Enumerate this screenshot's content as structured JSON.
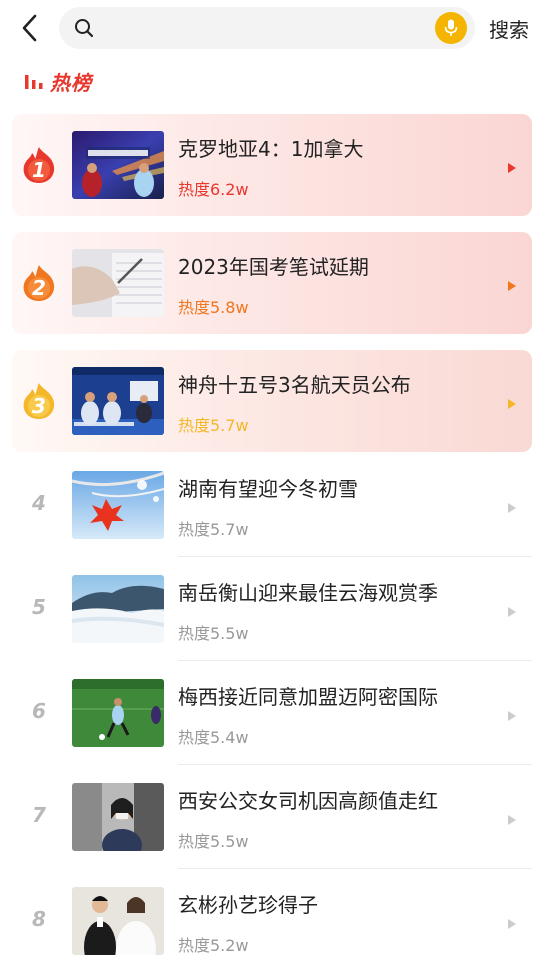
{
  "search": {
    "placeholder": "",
    "value": "",
    "button_label": "搜索"
  },
  "section": {
    "title": "热榜"
  },
  "colors": {
    "accent_red": "#e8372d",
    "accent_orange": "#f0761f",
    "accent_yellow": "#f5b72a",
    "mic_bg": "#f4b400"
  },
  "items": [
    {
      "rank": "1",
      "title": "克罗地亚4：1加拿大",
      "heat": "热度6.2w",
      "image": "world-cup-news-thumbnail"
    },
    {
      "rank": "2",
      "title": "2023年国考笔试延期",
      "heat": "热度5.8w",
      "image": "exam-paper-writing-thumbnail"
    },
    {
      "rank": "3",
      "title": "神舟十五号3名航天员公布",
      "heat": "热度5.7w",
      "image": "astronauts-press-conference-thumbnail"
    },
    {
      "rank": "4",
      "title": "湖南有望迎今冬初雪",
      "heat": "热度5.7w",
      "image": "red-maple-leaf-sky-thumbnail"
    },
    {
      "rank": "5",
      "title": "南岳衡山迎来最佳云海观赏季",
      "heat": "热度5.5w",
      "image": "mountain-sea-of-clouds-thumbnail"
    },
    {
      "rank": "6",
      "title": "梅西接近同意加盟迈阿密国际",
      "heat": "热度5.4w",
      "image": "soccer-player-on-field-thumbnail"
    },
    {
      "rank": "7",
      "title": "西安公交女司机因高颜值走红",
      "heat": "热度5.5w",
      "image": "bus-driver-in-uniform-thumbnail"
    },
    {
      "rank": "8",
      "title": "玄彬孙艺珍得子",
      "heat": "热度5.2w",
      "image": "wedding-couple-thumbnail"
    }
  ]
}
